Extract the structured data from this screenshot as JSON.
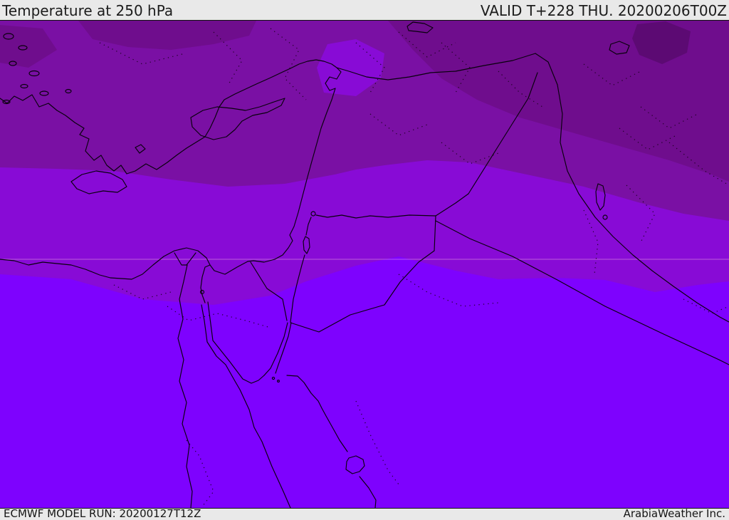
{
  "header": {
    "title": "Temperature at 250 hPa",
    "valid_label": "VALID T+228 THU. 20200206T00Z"
  },
  "footer": {
    "model_run": "ECMWF MODEL RUN: 20200127T12Z",
    "credit": "ArabiaWeather Inc."
  },
  "map": {
    "parameter": "Temperature at 250 hPa",
    "model": "ECMWF",
    "region": "Middle East / Eastern Mediterranean",
    "colors": {
      "band_coldest": "#5c0a73",
      "band_very_cold": "#6f0d8d",
      "band_cold": "#7a10a4",
      "band_mild": "#880bd6",
      "band_warm": "#7e02fe",
      "coastline": "#08000c",
      "lat_line": "#f2aede",
      "bar_background": "#e9e9e9",
      "bar_text": "#1c1c1c"
    }
  }
}
